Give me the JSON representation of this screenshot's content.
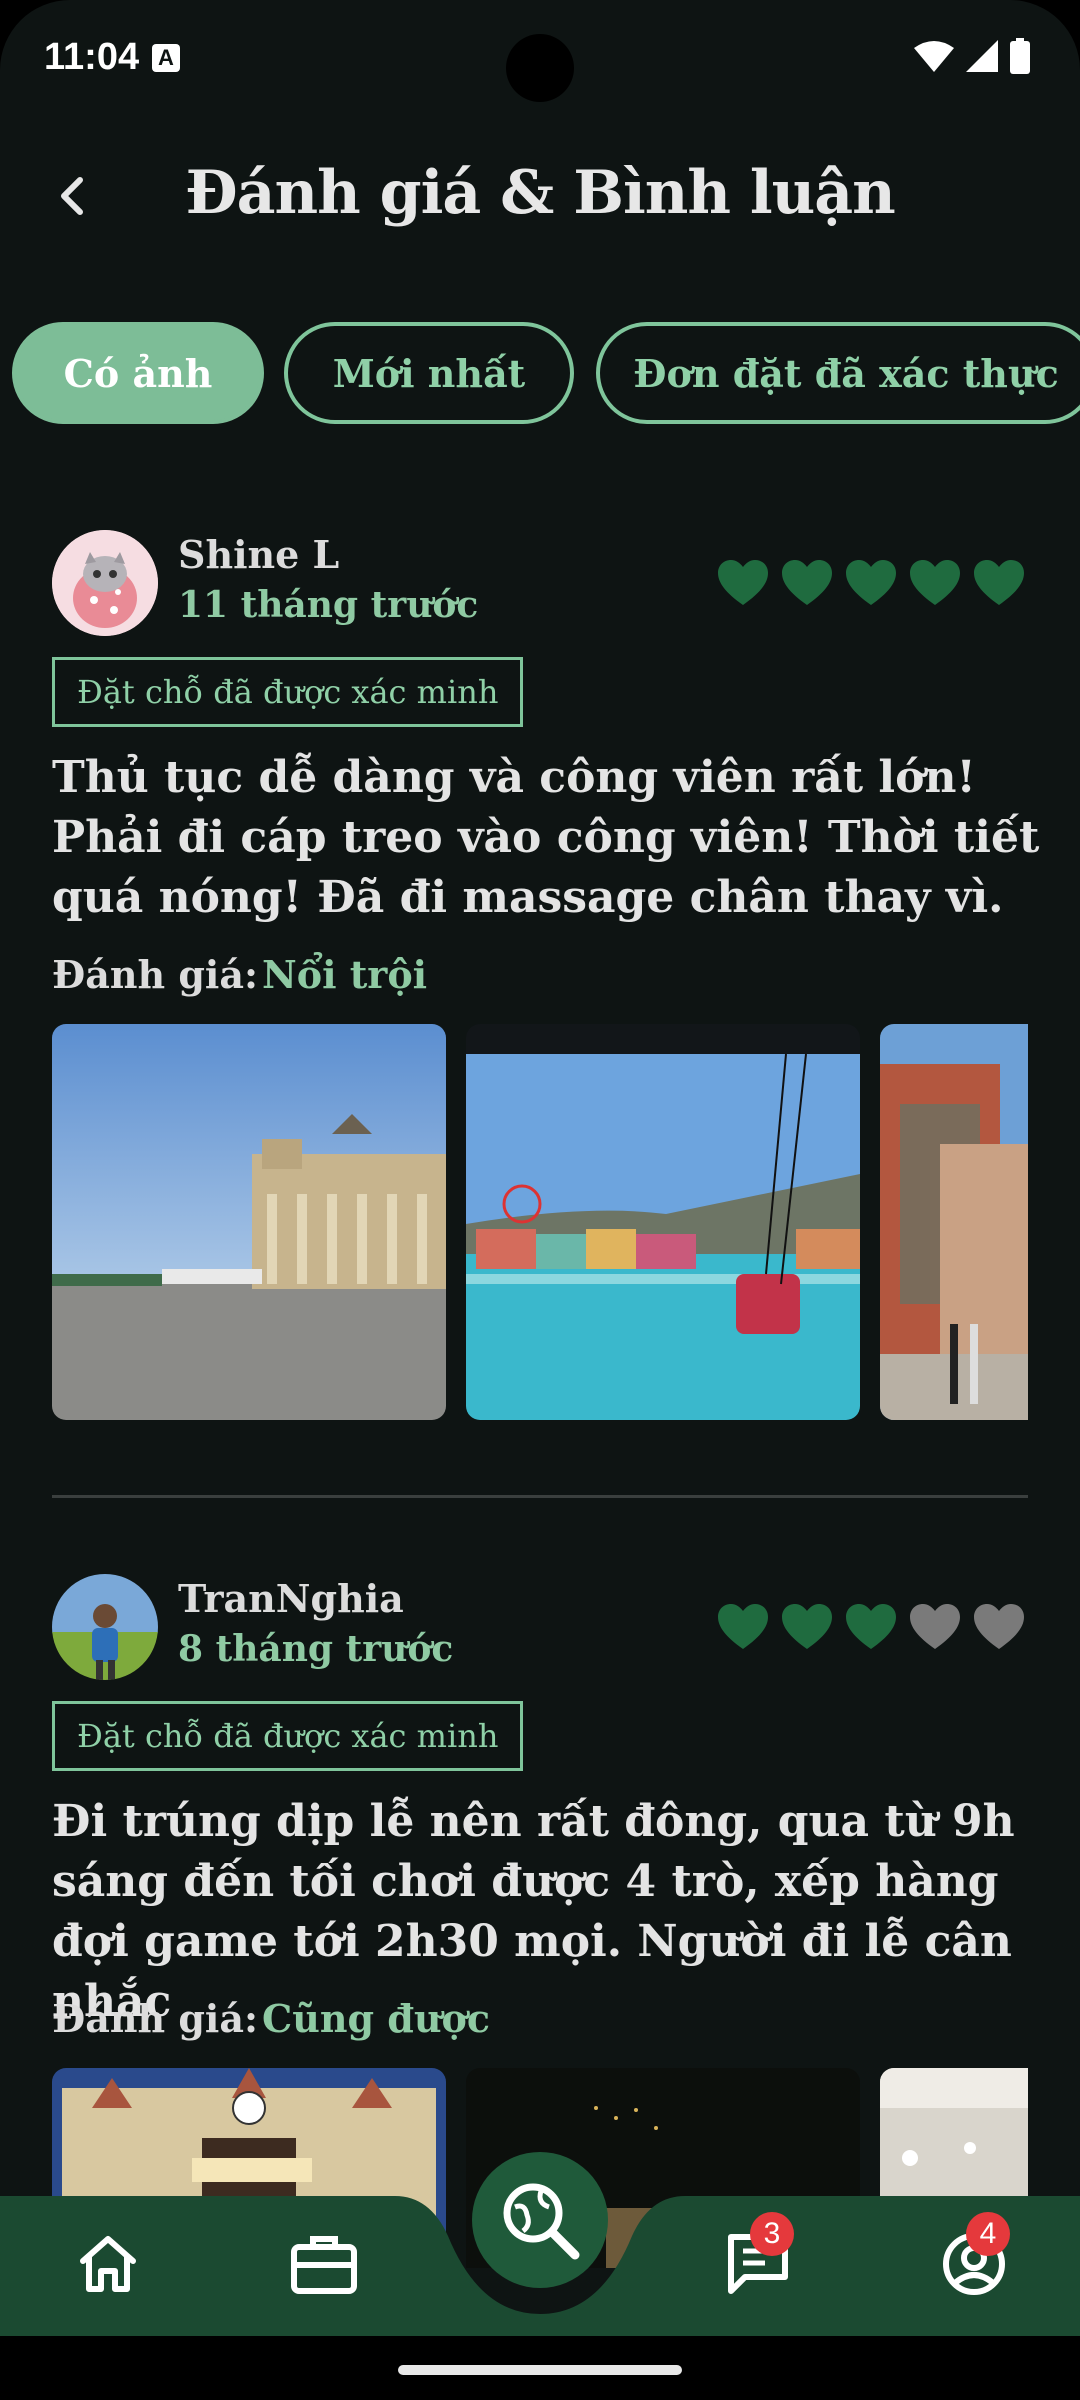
{
  "status": {
    "time": "11:04",
    "notif_icon": "A"
  },
  "header": {
    "title": "Đánh giá & Bình luận"
  },
  "chips": [
    {
      "label": "Có ảnh",
      "active": true
    },
    {
      "label": "Mới nhất",
      "active": false
    },
    {
      "label": "Đơn đặt đã xác thực",
      "active": false
    }
  ],
  "reviews": [
    {
      "name": "Shine L",
      "time": "11 tháng trước",
      "hearts_filled": 5,
      "hearts_total": 5,
      "verified": "Đặt chỗ đã được xác minh",
      "text": "Thủ tục dễ dàng và công viên rất lớn! Phải đi cáp treo vào công viên! Thời tiết quá nóng! Đã đi massage chân thay vì.",
      "rating_label": "Đánh giá:",
      "rating_value": "Nổi trội"
    },
    {
      "name": "TranNghia",
      "time": "8 tháng trước",
      "hearts_filled": 3,
      "hearts_total": 5,
      "verified": "Đặt chỗ đã được xác minh",
      "text": "Đi trúng dịp lễ nên rất đông, qua từ 9h sáng đến tối chơi được 4 trò, xếp hàng đợi game tới 2h30 mọi. Người đi lễ cân nhắc",
      "rating_label": "Đánh giá:",
      "rating_value": "Cũng được"
    }
  ],
  "nav": {
    "messages_badge": "3",
    "profile_badge": "4"
  },
  "colors": {
    "accent": "#7fc59b",
    "heart_filled": "#1f6b3f",
    "heart_empty": "#7a7a7a",
    "nav_bg": "#1b4a31"
  }
}
